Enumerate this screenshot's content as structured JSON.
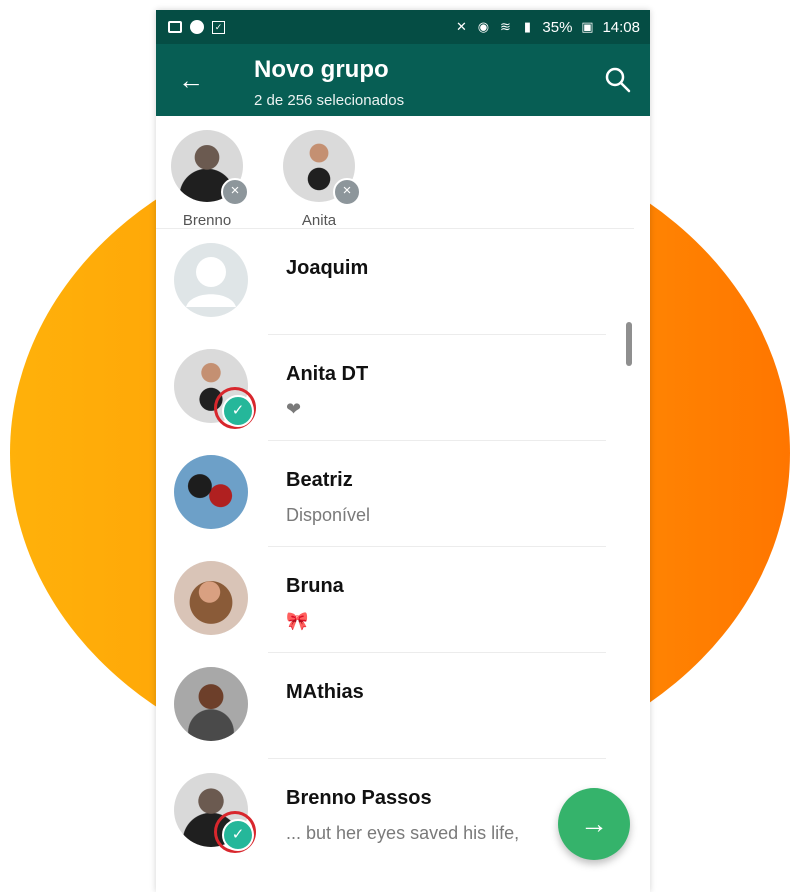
{
  "status": {
    "battery": "35%",
    "time": "14:08",
    "icons": [
      "image-icon",
      "music-icon",
      "checkbox-icon",
      "mute-icon",
      "alarm-icon",
      "wifi-icon",
      "signal-icon",
      "battery-icon"
    ]
  },
  "header": {
    "title": "Novo grupo",
    "subtitle": "2 de 256 selecionados",
    "back_icon": "arrow-left-icon",
    "search_icon": "search-icon"
  },
  "selected": [
    {
      "name": "Brenno"
    },
    {
      "name": "Anita"
    }
  ],
  "contacts": [
    {
      "name": "Joaquim",
      "status": "",
      "selected": false,
      "avatar": "placeholder-avatar"
    },
    {
      "name": "Anita DT",
      "status": "❤",
      "selected": true,
      "avatar": "child-avatar"
    },
    {
      "name": "Beatriz",
      "status": "Disponível",
      "selected": false,
      "avatar": "couple-avatar"
    },
    {
      "name": "Bruna",
      "status": "🎀",
      "selected": false,
      "avatar": "woman-avatar"
    },
    {
      "name": "MAthias",
      "status": "",
      "selected": false,
      "avatar": "man-avatar"
    },
    {
      "name": "Brenno Passos",
      "status": "... but her eyes saved his life,",
      "selected": true,
      "avatar": "bearded-man-avatar"
    }
  ],
  "fab": {
    "icon": "arrow-right-icon"
  },
  "colors": {
    "primary": "#075e54",
    "status_bar": "#054d44",
    "fab": "#35b36b",
    "check": "#25b79a",
    "annotation": "#d8272d",
    "background_left": "#ffb10a",
    "background_right": "#ff7600"
  }
}
